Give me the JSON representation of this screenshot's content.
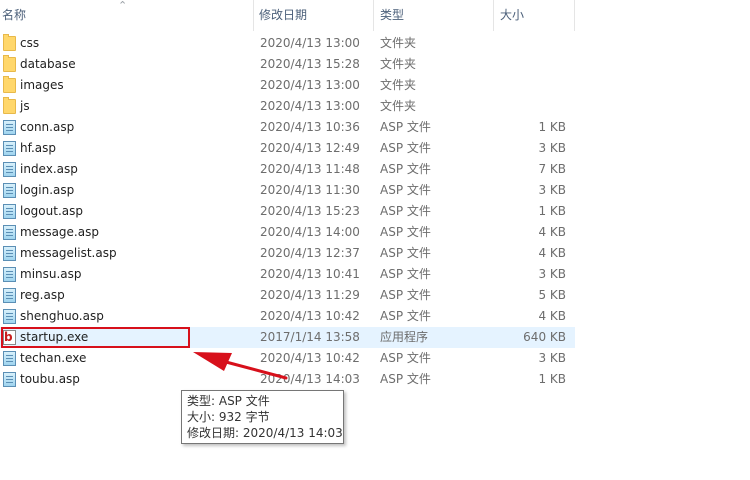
{
  "columns": {
    "name": "名称",
    "modified": "修改日期",
    "type": "类型",
    "size": "大小"
  },
  "files": [
    {
      "name": "css",
      "date": "2020/4/13 13:00",
      "type": "文件夹",
      "size": "",
      "kind": "folder"
    },
    {
      "name": "database",
      "date": "2020/4/13 15:28",
      "type": "文件夹",
      "size": "",
      "kind": "folder"
    },
    {
      "name": "images",
      "date": "2020/4/13 13:00",
      "type": "文件夹",
      "size": "",
      "kind": "folder"
    },
    {
      "name": "js",
      "date": "2020/4/13 13:00",
      "type": "文件夹",
      "size": "",
      "kind": "folder"
    },
    {
      "name": "conn.asp",
      "date": "2020/4/13 10:36",
      "type": "ASP 文件",
      "size": "1 KB",
      "kind": "asp"
    },
    {
      "name": "hf.asp",
      "date": "2020/4/13 12:49",
      "type": "ASP 文件",
      "size": "3 KB",
      "kind": "asp"
    },
    {
      "name": "index.asp",
      "date": "2020/4/13 11:48",
      "type": "ASP 文件",
      "size": "7 KB",
      "kind": "asp"
    },
    {
      "name": "login.asp",
      "date": "2020/4/13 11:30",
      "type": "ASP 文件",
      "size": "3 KB",
      "kind": "asp"
    },
    {
      "name": "logout.asp",
      "date": "2020/4/13 15:23",
      "type": "ASP 文件",
      "size": "1 KB",
      "kind": "asp"
    },
    {
      "name": "message.asp",
      "date": "2020/4/13 14:00",
      "type": "ASP 文件",
      "size": "4 KB",
      "kind": "asp"
    },
    {
      "name": "messagelist.asp",
      "date": "2020/4/13 12:37",
      "type": "ASP 文件",
      "size": "4 KB",
      "kind": "asp"
    },
    {
      "name": "minsu.asp",
      "date": "2020/4/13 10:41",
      "type": "ASP 文件",
      "size": "3 KB",
      "kind": "asp"
    },
    {
      "name": "reg.asp",
      "date": "2020/4/13 11:29",
      "type": "ASP 文件",
      "size": "5 KB",
      "kind": "asp"
    },
    {
      "name": "shenghuo.asp",
      "date": "2020/4/13 10:42",
      "type": "ASP 文件",
      "size": "4 KB",
      "kind": "asp"
    },
    {
      "name": "startup.exe",
      "date": "2017/1/14 13:58",
      "type": "应用程序",
      "size": "640 KB",
      "kind": "exe"
    },
    {
      "name": "techan.exe",
      "date": "2020/4/13 10:42",
      "type": "ASP 文件",
      "size": "3 KB",
      "kind": "asp"
    },
    {
      "name": "toubu.asp",
      "date": "2020/4/13 14:03",
      "type": "ASP 文件",
      "size": "1 KB",
      "kind": "asp"
    }
  ],
  "highlight_index": 14,
  "exe_icon_letter": "b",
  "tooltip": {
    "type_line": "类型: ASP 文件",
    "size_line": "大小: 932 字节",
    "date_line": "修改日期: 2020/4/13 14:03"
  },
  "colors": {
    "annotation_red": "#d7101b",
    "hover_row": "#e5f3ff"
  }
}
